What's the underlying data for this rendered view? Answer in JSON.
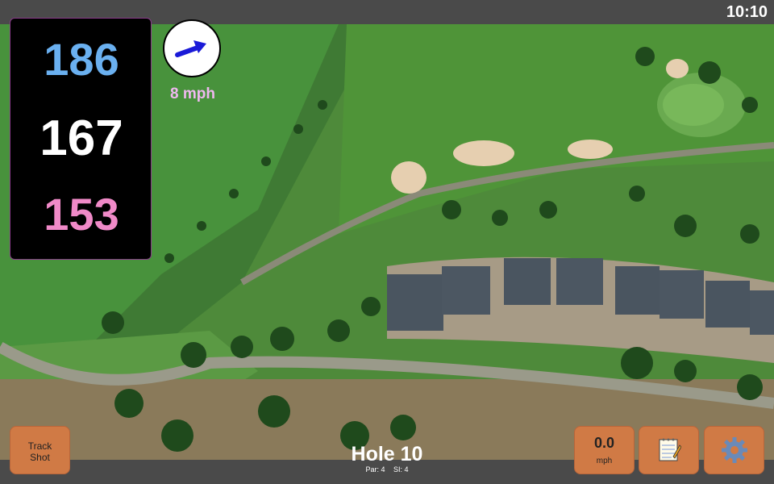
{
  "status_bar": {
    "time": "10:10"
  },
  "distances": {
    "back": {
      "value": "186",
      "color": "#6ab0f0"
    },
    "middle": {
      "value": "167",
      "color": "#ffffff"
    },
    "front": {
      "value": "153",
      "color": "#f08ac8"
    }
  },
  "wind": {
    "speed_label": "8 mph",
    "icon": "wind-direction-arrow-icon",
    "arrow_color": "#1a1ad8",
    "label_color": "#f0b8f0"
  },
  "buttons": {
    "track_shot": {
      "line1": "Track",
      "line2": "Shot"
    },
    "speed": {
      "value": "0.0",
      "unit": "mph"
    },
    "notes": {
      "icon": "notepad-icon"
    },
    "settings": {
      "icon": "gear-icon"
    },
    "color": "#d07a45"
  },
  "hole": {
    "title": "Hole 10",
    "par": "Par: 4",
    "si": "SI: 4"
  }
}
